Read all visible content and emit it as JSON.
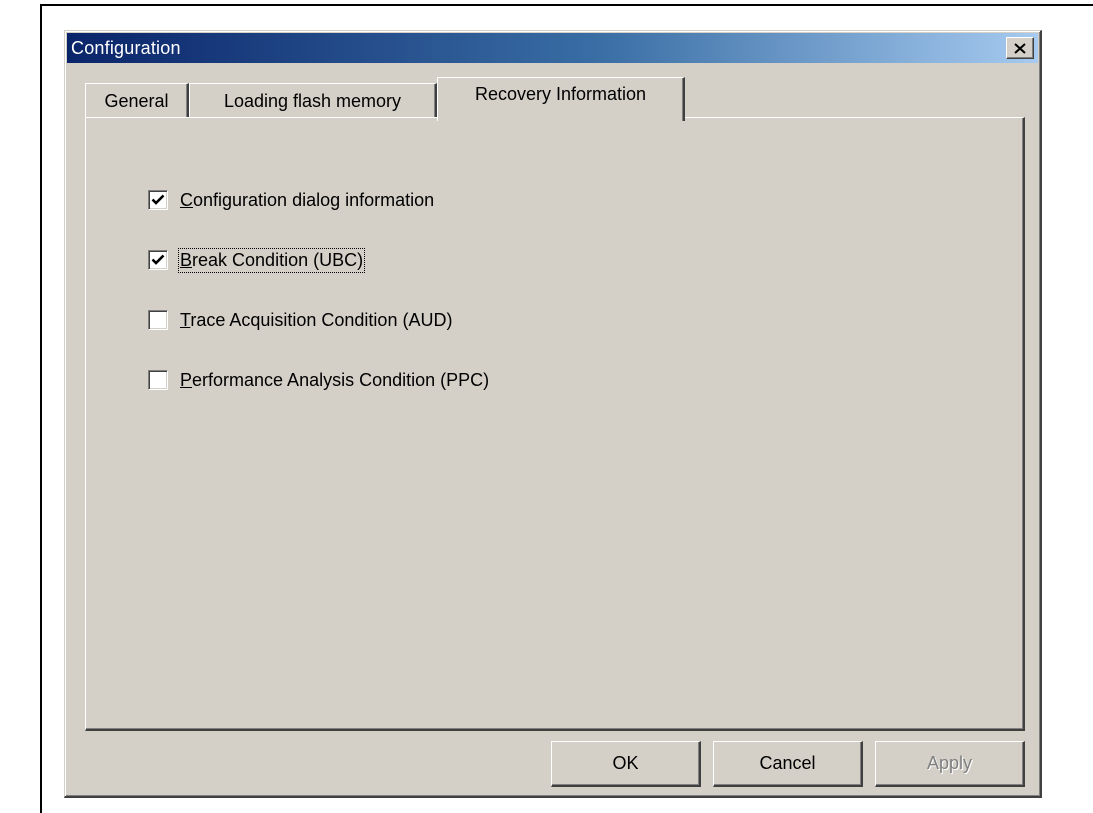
{
  "window": {
    "title": "Configuration",
    "close_icon": "close-icon"
  },
  "tabs": [
    {
      "label": "General",
      "selected": false
    },
    {
      "label": "Loading flash memory",
      "selected": false
    },
    {
      "label": "Recovery Information",
      "selected": true
    }
  ],
  "options": [
    {
      "label": "Configuration dialog information",
      "mnemonic": "C",
      "checked": true
    },
    {
      "label": "Break Condition (UBC)",
      "mnemonic": "B",
      "checked": true,
      "focused": true
    },
    {
      "label": "Trace Acquisition Condition (AUD)",
      "mnemonic": "T",
      "checked": false
    },
    {
      "label": "Performance Analysis Condition (PPC)",
      "mnemonic": "P",
      "checked": false
    }
  ],
  "buttons": {
    "ok": "OK",
    "cancel": "Cancel",
    "apply": "Apply",
    "apply_enabled": false
  },
  "colors": {
    "titlebar_start": "#0a246a",
    "titlebar_end": "#a6caf0",
    "face": "#d4d0c8"
  }
}
